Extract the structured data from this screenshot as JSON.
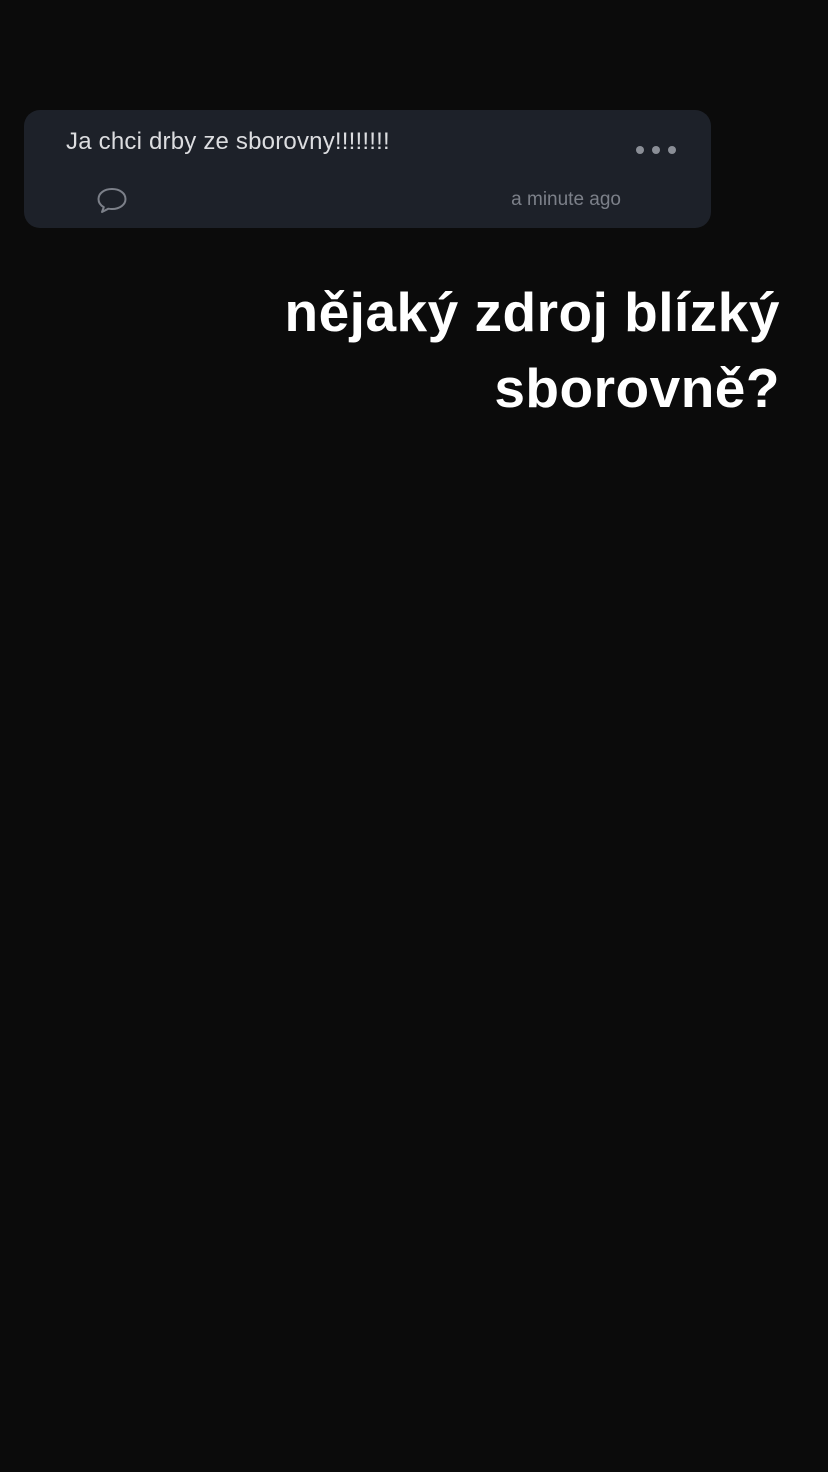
{
  "question_card": {
    "text": "Ja chci drby ze sborovny!!!!!!!!",
    "timestamp": "a minute ago",
    "more_icon": "ellipsis-icon",
    "comment_icon": "speech-bubble-icon"
  },
  "caption": {
    "text": "nějaký zdroj blízký sborovně?"
  },
  "colors": {
    "background": "#0b0b0b",
    "card": "#1d2129",
    "caption_text": "#ffffff"
  }
}
